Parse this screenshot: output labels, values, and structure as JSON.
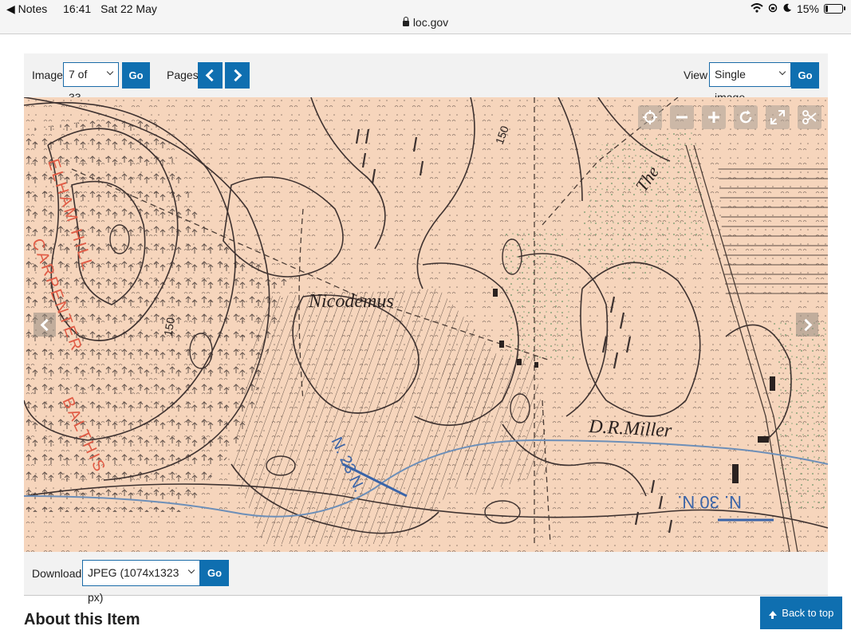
{
  "status_bar": {
    "back_app": "Notes",
    "time": "16:41",
    "date": "Sat 22 May",
    "battery": "15%",
    "battery_level": 0.15,
    "url": "loc.gov"
  },
  "toolbar": {
    "image_label": "Image",
    "image_select_value": "7 of 33",
    "go_label": "Go",
    "pages_label": "Pages",
    "view_label": "View",
    "view_select_value": "Single image"
  },
  "map": {
    "labels": [
      "Nicodemus",
      "D.R.Miller",
      "The",
      "150",
      "150",
      "ELHAM HILL",
      "CARPENTER",
      "BALTHIS",
      "N. 23 N.",
      "N. 30 N."
    ]
  },
  "viewer_controls": [
    "home-icon",
    "zoom-out-icon",
    "zoom-in-icon",
    "rotate-icon",
    "fullscreen-icon",
    "crop-icon"
  ],
  "download": {
    "label": "Download",
    "select_value": "JPEG (1074x1323 px)",
    "go_label": "Go"
  },
  "section_title": "About this Item",
  "back_to_top": "Back to top",
  "colors": {
    "accent": "#0f6fb0",
    "map_paper": "#f6d5bc",
    "map_red": "#e05a44",
    "map_blue": "#3a64a8"
  }
}
